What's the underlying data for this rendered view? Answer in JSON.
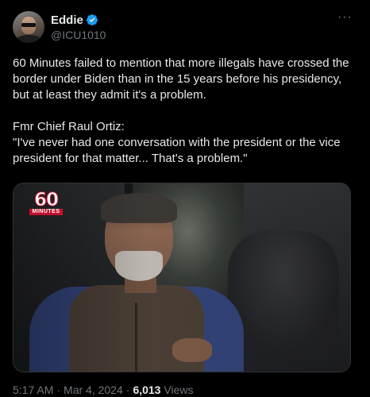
{
  "author": {
    "display_name": "Eddie",
    "handle": "@ICU1010",
    "verified": true
  },
  "tweet": {
    "text": "60 Minutes failed to mention that more illegals have crossed the border under Biden than in the 15 years before his presidency, but at least they admit it's a problem.\n\nFmr Chief Raul Ortiz:\n\"I've never had one conversation with the president or the vice president for that matter... That's a problem.\""
  },
  "media": {
    "logo_number": "60",
    "logo_word": "MINUTES"
  },
  "meta": {
    "time": "5:17 AM",
    "date": "Mar 4, 2024",
    "separator": "·",
    "views_count": "6,013",
    "views_label": "Views"
  },
  "colors": {
    "background": "#000000",
    "text": "#e7e9ea",
    "muted": "#71767b",
    "verified": "#1d9bf0",
    "logo_red": "#c8102e"
  },
  "icons": {
    "verified": "verified-badge-icon",
    "more": "more-options-icon"
  }
}
